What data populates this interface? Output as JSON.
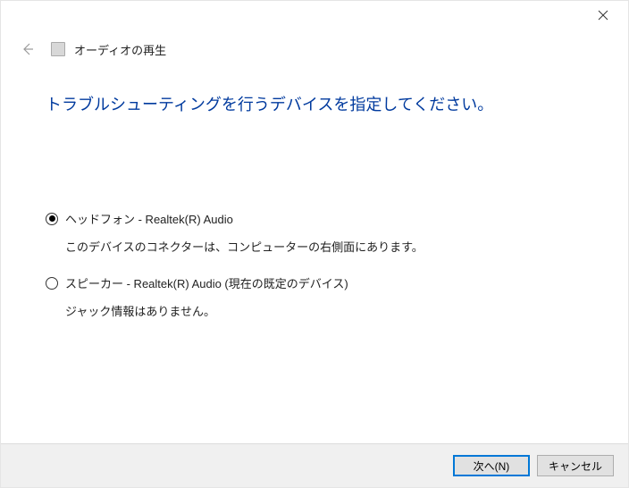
{
  "header": {
    "title": "オーディオの再生"
  },
  "main": {
    "heading": "トラブルシューティングを行うデバイスを指定してください。",
    "options": [
      {
        "label": "ヘッドフォン - Realtek(R) Audio",
        "description": "このデバイスのコネクターは、コンピューターの右側面にあります。",
        "selected": true
      },
      {
        "label": "スピーカー - Realtek(R) Audio (現在の既定のデバイス)",
        "description": "ジャック情報はありません。",
        "selected": false
      }
    ]
  },
  "footer": {
    "next": "次へ(N)",
    "cancel": "キャンセル"
  }
}
